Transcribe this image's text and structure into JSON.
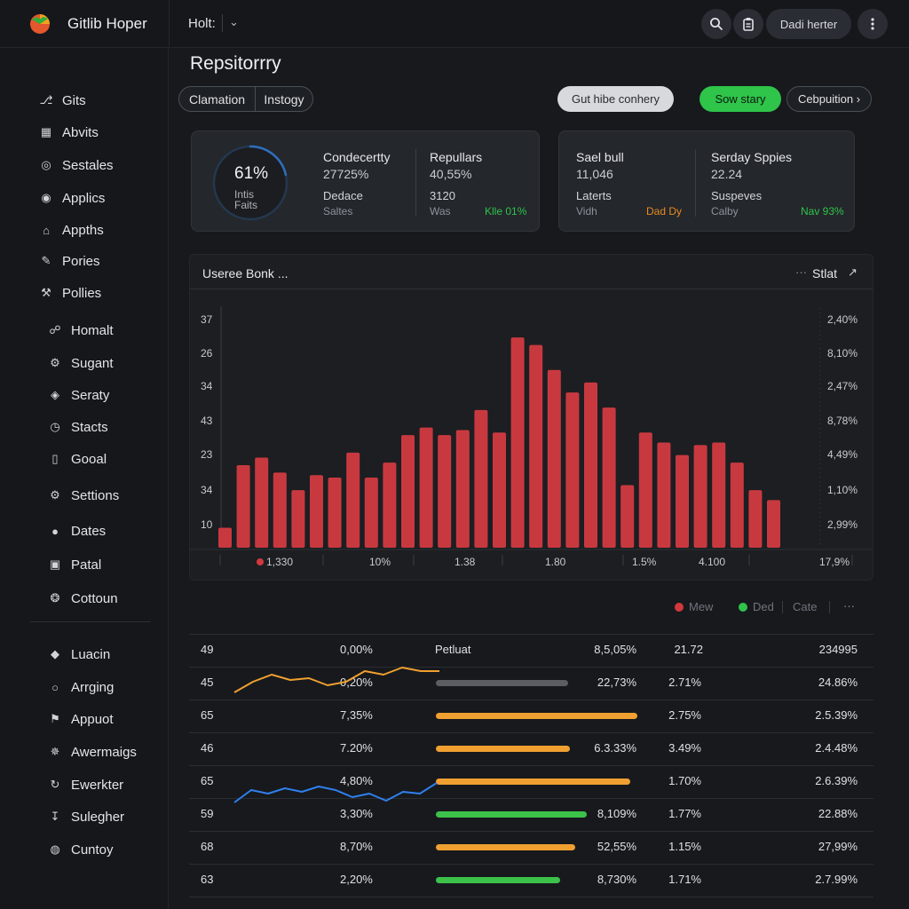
{
  "header": {
    "app_title": "Gitlib Hoper",
    "crumb": "Holt:",
    "crumb_chevron": "⌄",
    "pill_label": "Dadi herter",
    "icons": [
      "search-icon",
      "clipboard-icon",
      "more-vertical-icon"
    ]
  },
  "sidebar": {
    "items": [
      {
        "label": "Gits",
        "icon": "branch-icon",
        "glyph": "⎇"
      },
      {
        "label": "Abvits",
        "icon": "grid-icon",
        "glyph": "▦"
      },
      {
        "label": "Sestales",
        "icon": "globe-icon",
        "glyph": "◎"
      },
      {
        "label": "Applics",
        "icon": "target-icon",
        "glyph": "◉"
      },
      {
        "label": "Appths",
        "icon": "home-icon",
        "glyph": "⌂"
      },
      {
        "label": "Pories",
        "icon": "pencil-icon",
        "glyph": "✎"
      },
      {
        "label": "Pollies",
        "icon": "tools-icon",
        "glyph": "⚒"
      },
      {
        "label": "Homalt",
        "icon": "link-icon",
        "glyph": "☍"
      },
      {
        "label": "Sugant",
        "icon": "settings-icon",
        "glyph": "⚙"
      },
      {
        "label": "Seraty",
        "icon": "shield-icon",
        "glyph": "◈"
      },
      {
        "label": "Stacts",
        "icon": "clock-icon",
        "glyph": "◷"
      },
      {
        "label": "Gooal",
        "icon": "document-icon",
        "glyph": "▯"
      },
      {
        "label": "Settions",
        "icon": "gear-icon",
        "glyph": "⚙"
      },
      {
        "label": "Dates",
        "icon": "info-icon",
        "glyph": "●"
      },
      {
        "label": "Patal",
        "icon": "edit-icon",
        "glyph": "▣"
      },
      {
        "label": "Cottoun",
        "icon": "cog-icon",
        "glyph": "❂"
      },
      {
        "label": "Luacin",
        "icon": "lock-icon",
        "glyph": "◆"
      },
      {
        "label": "Arrging",
        "icon": "circle-icon",
        "glyph": "○"
      },
      {
        "label": "Appuot",
        "icon": "pin-icon",
        "glyph": "⚑"
      },
      {
        "label": "Awermaigs",
        "icon": "star-icon",
        "glyph": "✵"
      },
      {
        "label": "Ewerkter",
        "icon": "refresh-icon",
        "glyph": "↻"
      },
      {
        "label": "Sulegher",
        "icon": "download-icon",
        "glyph": "↧"
      },
      {
        "label": "Cuntoy",
        "icon": "world-icon",
        "glyph": "◍"
      }
    ]
  },
  "main": {
    "title": "Repsitorrry",
    "seg_a": "Clamation",
    "seg_b": "Instogy",
    "btn_light": "Gut hibe conhery",
    "btn_green": "Sow stary",
    "btn_outline": "Cebpuition ›"
  },
  "cards": {
    "left": {
      "gauge_value": "61%",
      "gauge_progress": 0.61,
      "gauge_sub1": "Intis",
      "gauge_sub2": "Faits",
      "col1_title": "Condecertty",
      "col1_value": "27725%",
      "col1_sub": "Dedace",
      "col1_muted": "Saltes",
      "col2_title": "Repullars",
      "col2_value": "40,55%",
      "col2_sub": "3120",
      "col2_muted": "Was",
      "col2_green": "Klle 01%"
    },
    "right": {
      "col1_title": "Sael bull",
      "col1_value": "11,046",
      "col1_sub": "Laterts",
      "col1_muted": "Vidh",
      "col1_orange": "Dad Dy",
      "col2_title": "Serday Sppies",
      "col2_value": "22.24",
      "col2_sub": "Suspeves",
      "col2_muted": "Calby",
      "col2_green": "Nav 93%"
    }
  },
  "chart_panel": {
    "title": "Useree Bonk ...",
    "more": "···",
    "stat_label": "Stlat",
    "link_glyph": "↗"
  },
  "chart_data": {
    "type": "bar",
    "values": [
      8,
      33,
      36,
      30,
      23,
      29,
      28,
      38,
      28,
      34,
      45,
      48,
      45,
      47,
      55,
      46,
      84,
      81,
      71,
      62,
      66,
      56,
      25,
      46,
      42,
      37,
      41,
      42,
      34,
      23,
      19
    ],
    "ylim": [
      0,
      100
    ],
    "left_ticks": [
      "37",
      "26",
      "34",
      "43",
      "23",
      "34",
      "10"
    ],
    "right_ticks": [
      "2,40%",
      "8,10%",
      "2,47%",
      "8,78%",
      "4,49%",
      "1,10%",
      "2,99%"
    ],
    "x_labels": [
      "1,330",
      "10%",
      "1.38",
      "1.80",
      "1.5%",
      "4.100",
      "17,9%"
    ],
    "bar_color": "#c8393f",
    "grid": false
  },
  "legend": {
    "items": [
      {
        "label": "Mew",
        "color": "#d2383d"
      },
      {
        "label": "Ded",
        "color": "#2fc44a"
      },
      {
        "label": "Cate",
        "color": ""
      }
    ],
    "more": "···"
  },
  "table": {
    "header": {
      "c1": "49",
      "c2": "0,00%",
      "c3": "Petluat",
      "c4": "8,5,05%",
      "c5": "21.72",
      "c6": "234995"
    },
    "rows": [
      {
        "c1": "45",
        "c2": "0,20%",
        "bar": 0.55,
        "bar_color": "#5a5d62",
        "c4": "22,73%",
        "c5": "2.71%",
        "c6": "24.86%"
      },
      {
        "c1": "65",
        "c2": "7,35%",
        "bar": 0.84,
        "bar_color": "#f0a030",
        "c4": "",
        "c5": "2.75%",
        "c6": "2.5.39%"
      },
      {
        "c1": "46",
        "c2": "7.20%",
        "bar": 0.56,
        "bar_color": "#f0a030",
        "c4": "6.3.33%",
        "c5": "3.49%",
        "c6": "2.4.48%"
      },
      {
        "c1": "65",
        "c2": "4,80%",
        "bar": 0.81,
        "bar_color": "#f0a030",
        "c4": "",
        "c5": "1.70%",
        "c6": "2.6.39%"
      },
      {
        "c1": "59",
        "c2": "3,30%",
        "bar": 0.63,
        "bar_color": "#3cc24a",
        "c4": "8,109%",
        "c5": "1.77%",
        "c6": "22.88%"
      },
      {
        "c1": "68",
        "c2": "8,70%",
        "bar": 0.58,
        "bar_color": "#f0a030",
        "c4": "52,55%",
        "c5": "1.15%",
        "c6": "27,99%"
      },
      {
        "c1": "63",
        "c2": "2,20%",
        "bar": 0.52,
        "bar_color": "#3cc24a",
        "c4": "8,730%",
        "c5": "1.71%",
        "c6": "2.7.99%"
      }
    ],
    "sparkline_orange": [
      10,
      22,
      30,
      24,
      26,
      18,
      22,
      34,
      30,
      38,
      34,
      34
    ],
    "sparkline_blue": [
      8,
      22,
      18,
      24,
      20,
      26,
      22,
      14,
      18,
      10,
      20,
      18,
      30
    ],
    "sparkline_colors": {
      "orange": "#f0a030",
      "blue": "#2f80ed"
    }
  }
}
